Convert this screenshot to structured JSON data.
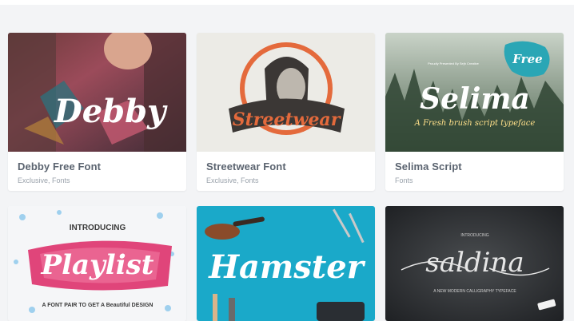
{
  "cards": [
    {
      "title": "Debby Free Font",
      "meta": "Exclusive, Fonts",
      "art_text": "Debby"
    },
    {
      "title": "Streetwear Font",
      "meta": "Exclusive, Fonts",
      "art_text": "Streetwear"
    },
    {
      "title": "Selima Script",
      "meta": "Fonts",
      "art_text": "Selima",
      "badge": "Free",
      "tagline": "A Fresh brush script typeface",
      "credit": "Proudly Presented By Sejh Creative"
    },
    {
      "art_intro": "INTRODUCING",
      "art_text": "Playlist",
      "tagline": "A FONT PAIR TO GET A Beautiful DESIGN"
    },
    {
      "art_text": "Hamster"
    },
    {
      "art_intro": "INTRODUCING",
      "art_text": "saldina",
      "tagline": "A NEW MODERN CALLIGRAPHY TYPEFACE"
    }
  ],
  "colors": {
    "page_bg": "#f3f4f6",
    "card_bg": "#ffffff",
    "title": "#5b6470",
    "meta": "#9aa2ab"
  }
}
